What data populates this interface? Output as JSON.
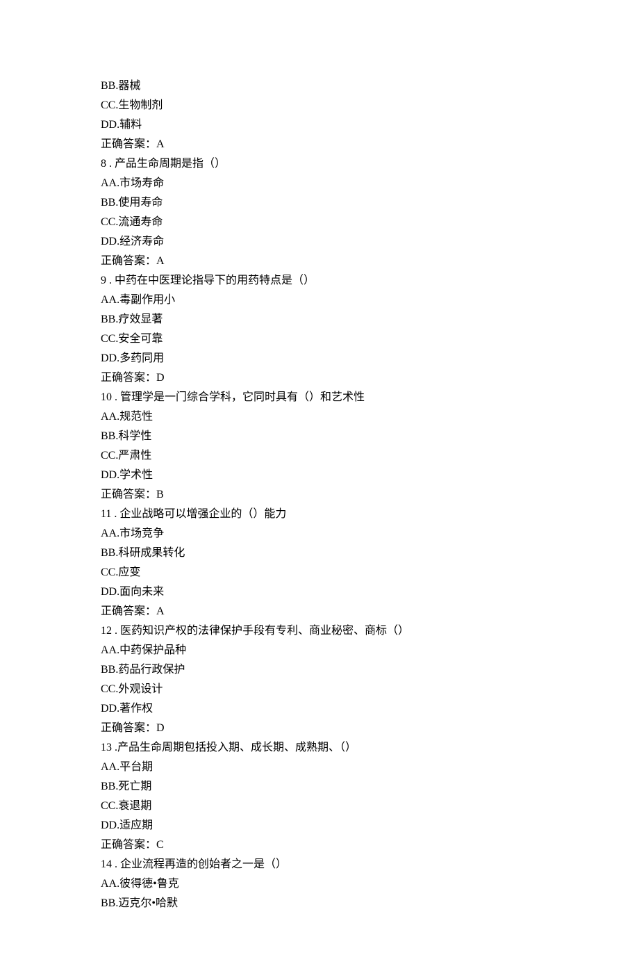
{
  "lines": [
    "BB.器械",
    "CC.生物制剂",
    "DD.辅料",
    "正确答案：A",
    "8  . 产品生命周期是指（）",
    "AA.市场寿命",
    "BB.使用寿命",
    "CC.流通寿命",
    "DD.经济寿命",
    "正确答案：A",
    "9  . 中药在中医理论指导下的用药特点是（）",
    "AA.毒副作用小",
    "BB.疗效显著",
    "CC.安全可靠",
    "DD.多药同用",
    "正确答案：D",
    "10   . 管理学是一门综合学科，它同时具有（）和艺术性",
    "AA.规范性",
    "BB.科学性",
    "CC.严肃性",
    "DD.学术性",
    "正确答案：B",
    "11  . 企业战略可以增强企业的（）能力",
    "AA.市场竞争",
    "BB.科研成果转化",
    "CC.应变",
    "DD.面向未来",
    "正确答案：A",
    "12  . 医药知识产权的法律保护手段有专利、商业秘密、商标（）",
    "AA.中药保护品种",
    "BB.药品行政保护",
    "CC.外观设计",
    "DD.著作权",
    "正确答案：D",
    "13  .产品生命周期包括投入期、成长期、成熟期、（）",
    "AA.平台期",
    "BB.死亡期",
    "CC.衰退期",
    "DD.适应期",
    "正确答案：C",
    "14  . 企业流程再造的创始者之一是（）",
    "AA.彼得德•鲁克",
    "BB.迈克尔•哈默"
  ]
}
